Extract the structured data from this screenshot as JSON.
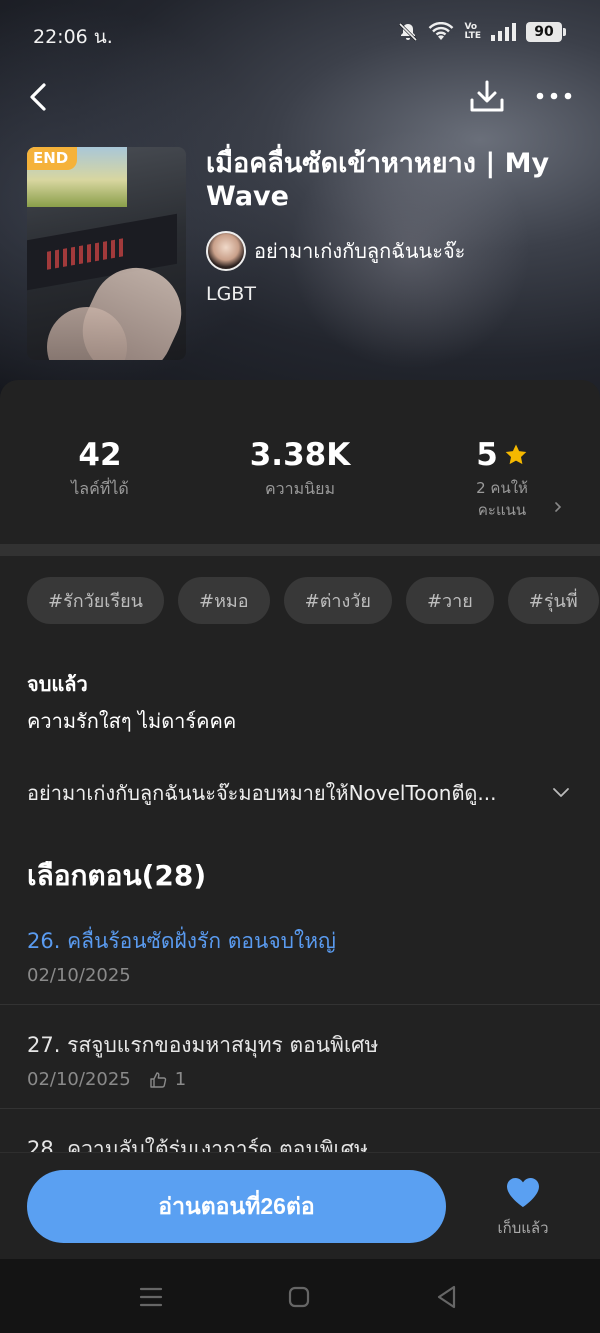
{
  "status_bar": {
    "time": "22:06 น.",
    "battery": "90"
  },
  "book": {
    "badge": "END",
    "title": "เมื่อคลื่นซัดเข้าหาหยาง | My Wave",
    "author": "อย่ามาเก่งกับลูกฉันนะจ๊ะ",
    "genre": "LGBT"
  },
  "stats": {
    "likes": {
      "value": "42",
      "label": "ไลค์ที่ได้"
    },
    "popularity": {
      "value": "3.38K",
      "label": "ความนิยม"
    },
    "rating": {
      "value": "5",
      "label_line1": "2 คนให้",
      "label_line2": "คะแนน"
    }
  },
  "tags": [
    "#รักวัยเรียน",
    "#หมอ",
    "#ต่างวัย",
    "#วาย",
    "#รุ่นพี่"
  ],
  "summary": {
    "status": "จบแล้ว",
    "tagline": "ความรักใสๆ ไม่ดาร์คคค",
    "description": "อย่ามาเก่งกับลูกฉันนะจ๊ะมอบหมายให้NovelToonตีดู..."
  },
  "episodes": {
    "heading": "เลือกตอน(28)",
    "items": [
      {
        "title": "26. คลื่นร้อนซัดฝั่งรัก ตอนจบใหญ่",
        "date": "02/10/2025",
        "likes": ""
      },
      {
        "title": "27. รสจูบแรกของมหาสมุทร ตอนพิเศษ",
        "date": "02/10/2025",
        "likes": "1"
      },
      {
        "title": "28. ความลับใต้ร่มเงาการ์ด ตอนพิเศษ",
        "date": "",
        "likes": ""
      }
    ]
  },
  "actions": {
    "read_button": "อ่านตอนที่26ต่อ",
    "favorite_label": "เก็บแล้ว"
  },
  "colors": {
    "accent": "#5aa0f2",
    "star": "#f5b800",
    "badge": "#f5b23a"
  }
}
